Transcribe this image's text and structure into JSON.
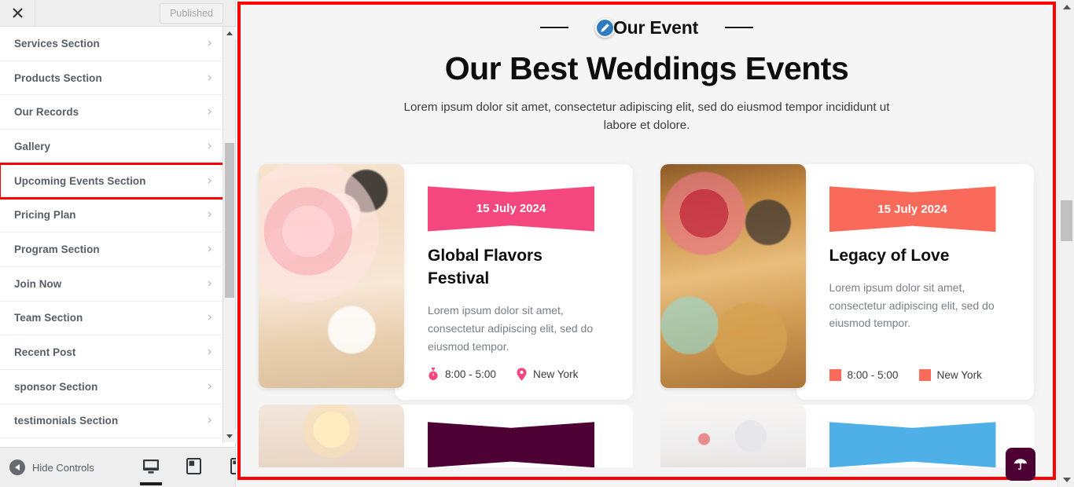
{
  "sidebar": {
    "close_label": "×",
    "published_label": "Published",
    "items": [
      {
        "label": "Services Section",
        "highlighted": false
      },
      {
        "label": "Products Section",
        "highlighted": false
      },
      {
        "label": "Our Records",
        "highlighted": false
      },
      {
        "label": "Gallery",
        "highlighted": false
      },
      {
        "label": "Upcoming Events Section",
        "highlighted": true
      },
      {
        "label": "Pricing Plan",
        "highlighted": false
      },
      {
        "label": "Program Section",
        "highlighted": false
      },
      {
        "label": "Join Now",
        "highlighted": false
      },
      {
        "label": "Team Section",
        "highlighted": false
      },
      {
        "label": "Recent Post",
        "highlighted": false
      },
      {
        "label": "sponsor Section",
        "highlighted": false
      },
      {
        "label": "testimonials Section",
        "highlighted": false
      }
    ],
    "footer": {
      "hide_controls_label": "Hide Controls",
      "devices": [
        {
          "name": "desktop",
          "active": true
        },
        {
          "name": "tablet",
          "active": false
        },
        {
          "name": "mobile",
          "active": false
        }
      ]
    }
  },
  "preview": {
    "eyebrow": "Our Event",
    "title": "Our Best Weddings Events",
    "description": "Lorem ipsum dolor sit amet, consectetur adipiscing elit, sed do eiusmod tempor incididunt ut labore et dolore.",
    "cards": [
      {
        "date": "15 July 2024",
        "title": "Global Flavors Festival",
        "text": "Lorem ipsum dolor sit amet, consectetur adipiscing elit, sed do eiusmod tempor.",
        "time": "8:00 - 5:00",
        "location": "New York",
        "ribbon_color": "#f4477f",
        "accent_color": "#f4477f",
        "time_icon": "stopwatch-icon",
        "location_icon": "map-pin-icon"
      },
      {
        "date": "15 July 2024",
        "title": "Legacy of Love",
        "text": "Lorem ipsum dolor sit amet, consectetur adipiscing elit, sed do eiusmod tempor.",
        "time": "8:00 - 5:00",
        "location": "New York",
        "ribbon_color": "#f96a5a",
        "accent_color": "#f96a5a",
        "time_icon": "square-placeholder-icon",
        "location_icon": "square-placeholder-icon"
      }
    ],
    "partial_cards": [
      {
        "ribbon_color": "#4d0033"
      },
      {
        "ribbon_color": "#4fb0e8"
      }
    ],
    "to_top_icon": "umbrella-glyph-icon",
    "to_top_bg": "#4d0033"
  }
}
